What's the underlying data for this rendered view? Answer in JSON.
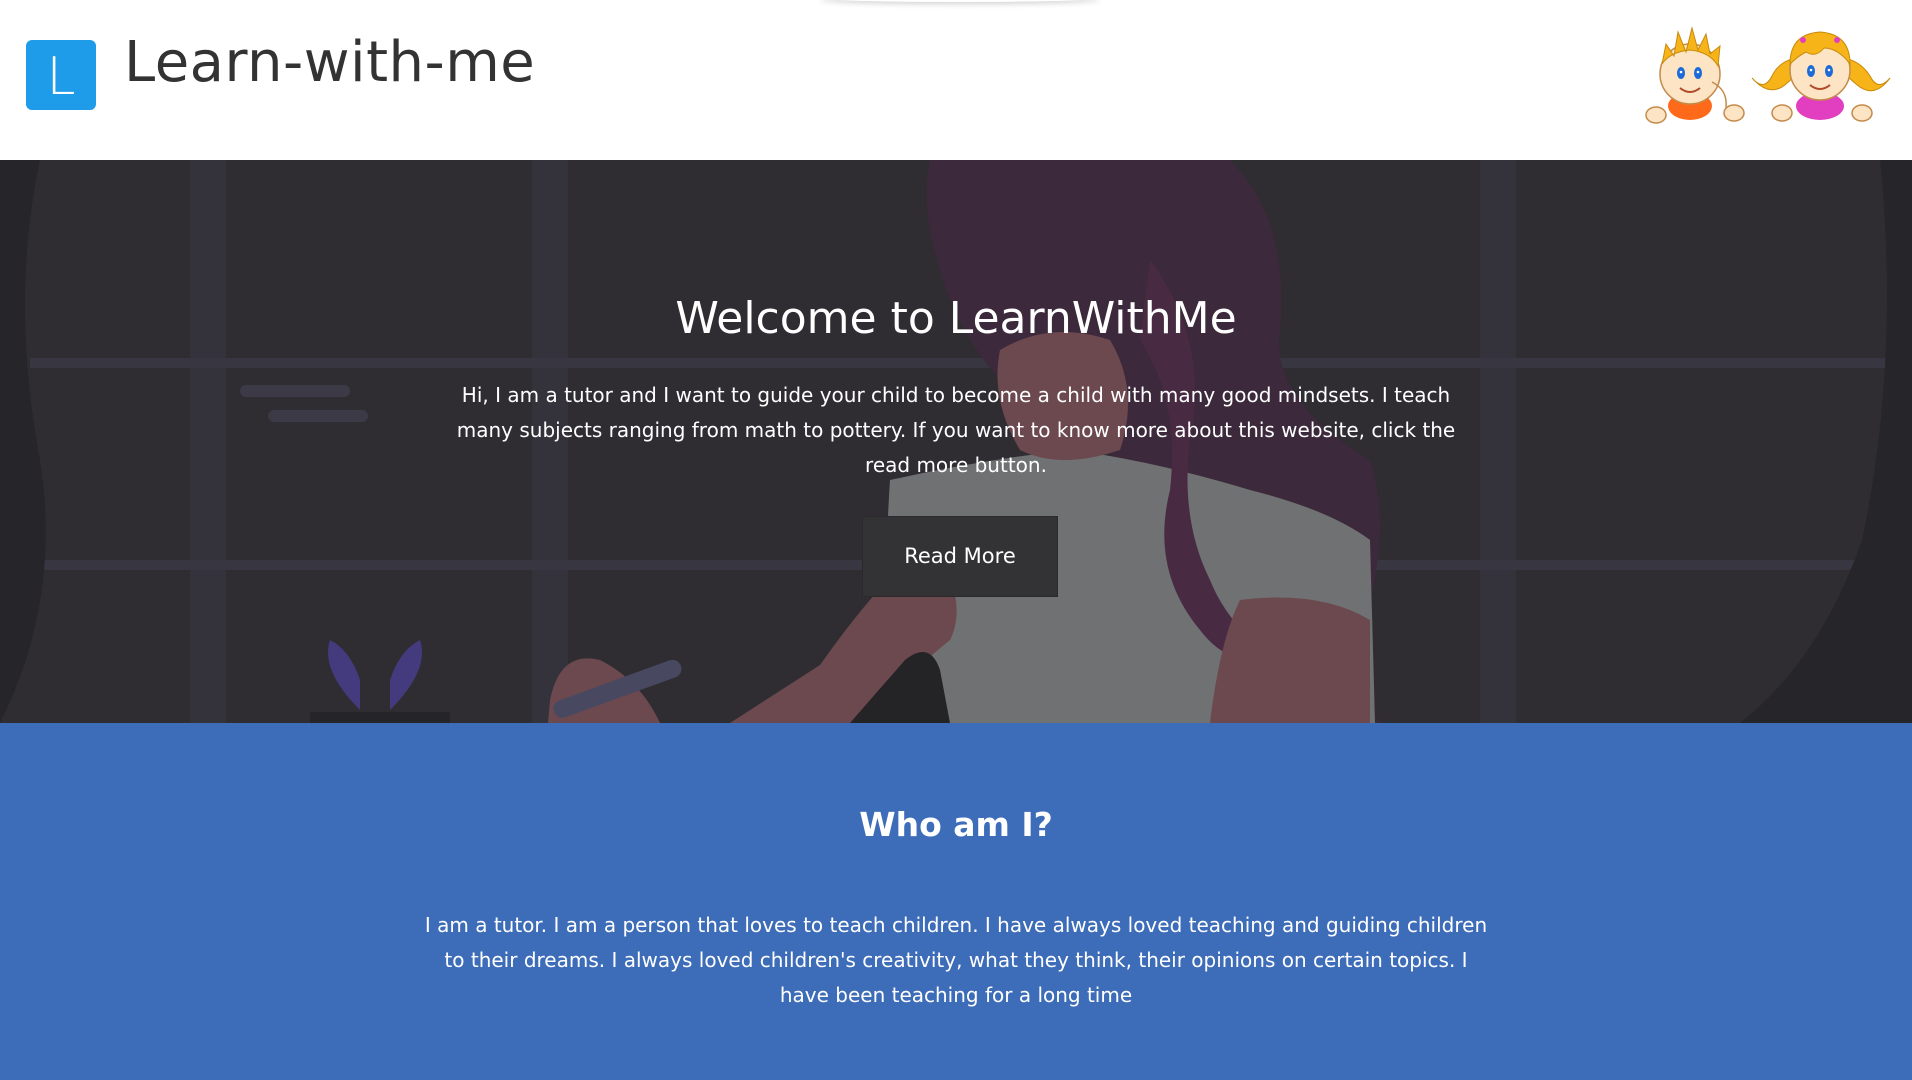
{
  "header": {
    "logo_letter": "L",
    "site_title": "Learn-with-me"
  },
  "hero": {
    "title": "Welcome to LearnWithMe",
    "text": "Hi, I am a tutor and I want to guide your child to become a child with many good mindsets. I teach many subjects ranging from math to pottery. If you want to know more about this website, click the read more button.",
    "button_label": "Read More"
  },
  "about": {
    "title": "Who am I?",
    "text": "I am a tutor. I am a person that loves to teach children. I have always loved teaching and guiding children to their dreams. I always loved children's creativity, what they think, their opinions on certain topics. I have been teaching for a long time"
  },
  "colors": {
    "logo_blue": "#1e9be9",
    "hero_bg": "#38363b",
    "about_bg": "#3d6cb9",
    "button_bg": "#333335"
  },
  "icons": {
    "logo": "letter-l-logo-icon",
    "kids": "kids-cartoon-image"
  }
}
